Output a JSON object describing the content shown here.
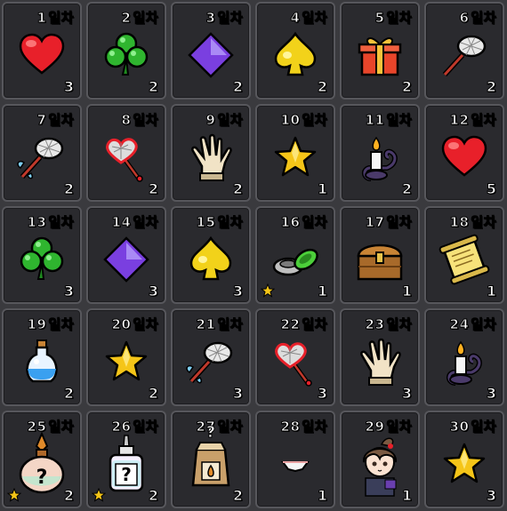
{
  "unit_label": "일차",
  "days": [
    {
      "day": "1",
      "qty": "3",
      "item": "heart"
    },
    {
      "day": "2",
      "qty": "2",
      "item": "clover"
    },
    {
      "day": "3",
      "qty": "2",
      "item": "diamond"
    },
    {
      "day": "4",
      "qty": "2",
      "item": "spade"
    },
    {
      "day": "5",
      "qty": "2",
      "item": "gift-box"
    },
    {
      "day": "6",
      "qty": "2",
      "item": "bug-net"
    },
    {
      "day": "7",
      "qty": "2",
      "item": "winged-net"
    },
    {
      "day": "8",
      "qty": "2",
      "item": "heart-net"
    },
    {
      "day": "9",
      "qty": "2",
      "item": "glove"
    },
    {
      "day": "10",
      "qty": "1",
      "item": "star"
    },
    {
      "day": "11",
      "qty": "2",
      "item": "candle"
    },
    {
      "day": "12",
      "qty": "5",
      "item": "heart"
    },
    {
      "day": "13",
      "qty": "3",
      "item": "clover"
    },
    {
      "day": "14",
      "qty": "3",
      "item": "diamond"
    },
    {
      "day": "15",
      "qty": "3",
      "item": "spade"
    },
    {
      "day": "16",
      "qty": "1",
      "item": "bracelets",
      "grade_star": true
    },
    {
      "day": "17",
      "qty": "1",
      "item": "treasure-chest"
    },
    {
      "day": "18",
      "qty": "1",
      "item": "scroll"
    },
    {
      "day": "19",
      "qty": "2",
      "item": "potion"
    },
    {
      "day": "20",
      "qty": "2",
      "item": "star"
    },
    {
      "day": "21",
      "qty": "3",
      "item": "winged-net"
    },
    {
      "day": "22",
      "qty": "3",
      "item": "heart-net"
    },
    {
      "day": "23",
      "qty": "3",
      "item": "glove"
    },
    {
      "day": "24",
      "qty": "3",
      "item": "candle"
    },
    {
      "day": "25",
      "qty": "2",
      "item": "mystery-flask",
      "grade_star": true
    },
    {
      "day": "26",
      "qty": "2",
      "item": "mystery-bottle",
      "grade_star": true
    },
    {
      "day": "27",
      "qty": "2",
      "item": "mystery-seed-bag"
    },
    {
      "day": "28",
      "qty": "1",
      "item": "underwear"
    },
    {
      "day": "29",
      "qty": "1",
      "item": "character-portrait"
    },
    {
      "day": "30",
      "qty": "3",
      "item": "star"
    }
  ],
  "colors": {
    "day_number": "#ffffff",
    "unit_text": "#f5d817",
    "cell_bg": "#2a2a2e",
    "cell_border": "#57575c"
  }
}
